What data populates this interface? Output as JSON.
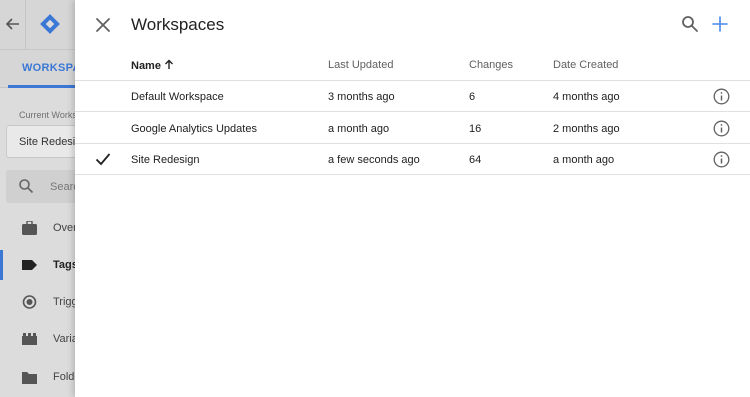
{
  "background": {
    "tab_label": "WORKSPACES",
    "current_workspace_label": "Current Workspace",
    "current_workspace_value": "Site Redesign",
    "search_placeholder": "Search",
    "nav_items": [
      {
        "label": "Overview",
        "icon": "briefcase-icon"
      },
      {
        "label": "Tags",
        "icon": "tag-icon"
      },
      {
        "label": "Triggers",
        "icon": "trigger-icon"
      },
      {
        "label": "Variables",
        "icon": "variables-icon"
      },
      {
        "label": "Folders",
        "icon": "folder-icon"
      }
    ],
    "accent_color": "#3b78d6"
  },
  "sheet": {
    "title": "Workspaces",
    "columns": {
      "name": "Name",
      "last_updated": "Last Updated",
      "changes": "Changes",
      "date_created": "Date Created"
    },
    "sort": {
      "column": "name",
      "direction": "ascending"
    },
    "rows": [
      {
        "name": "Default Workspace",
        "last_updated": "3 months ago",
        "changes": "6",
        "date_created": "4 months ago",
        "selected": false
      },
      {
        "name": "Google Analytics Updates",
        "last_updated": "a month ago",
        "changes": "16",
        "date_created": "2 months ago",
        "selected": false
      },
      {
        "name": "Site Redesign",
        "last_updated": "a few seconds ago",
        "changes": "64",
        "date_created": "a month ago",
        "selected": true
      }
    ],
    "icons": {
      "close": "close-icon",
      "search": "search-icon",
      "add": "add-icon",
      "info": "info-icon",
      "check": "check-icon",
      "sort": "arrow-up-icon"
    }
  }
}
